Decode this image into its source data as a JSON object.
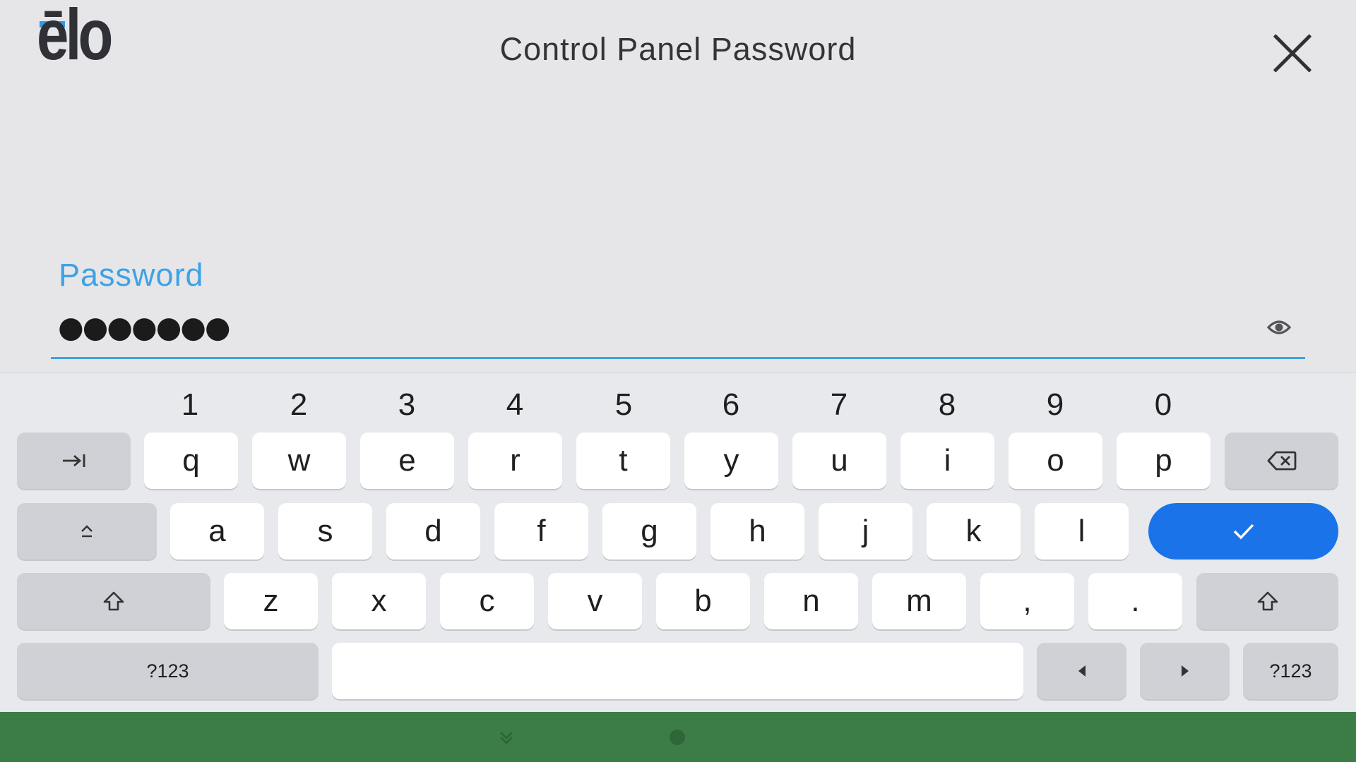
{
  "header": {
    "logo_text": "ēlo",
    "title": "Control Panel Password",
    "close_icon": "close-icon"
  },
  "password": {
    "label": "Password",
    "masked_value": "●●●●●●●",
    "toggle_icon": "eye-icon"
  },
  "keyboard": {
    "digits": [
      "1",
      "2",
      "3",
      "4",
      "5",
      "6",
      "7",
      "8",
      "9",
      "0"
    ],
    "row1": [
      "q",
      "w",
      "e",
      "r",
      "t",
      "y",
      "u",
      "i",
      "o",
      "p"
    ],
    "row2": [
      "a",
      "s",
      "d",
      "f",
      "g",
      "h",
      "j",
      "k",
      "l"
    ],
    "row3": [
      "z",
      "x",
      "c",
      "v",
      "b",
      "n",
      "m",
      ",",
      "."
    ],
    "symbols_label": "?123",
    "icons": {
      "tab": "tab-icon",
      "backspace": "backspace-icon",
      "caps": "caps-lock-icon",
      "enter": "check-icon",
      "shift": "shift-icon",
      "left": "arrow-left-icon",
      "right": "arrow-right-icon"
    },
    "accent": "#1a73e8"
  },
  "navbar": {
    "color": "#3c7d47",
    "icons": [
      "nav-down-icon",
      "nav-home-icon"
    ]
  },
  "colors": {
    "label_blue": "#3ea2e6",
    "background": "#e6e6e8"
  }
}
